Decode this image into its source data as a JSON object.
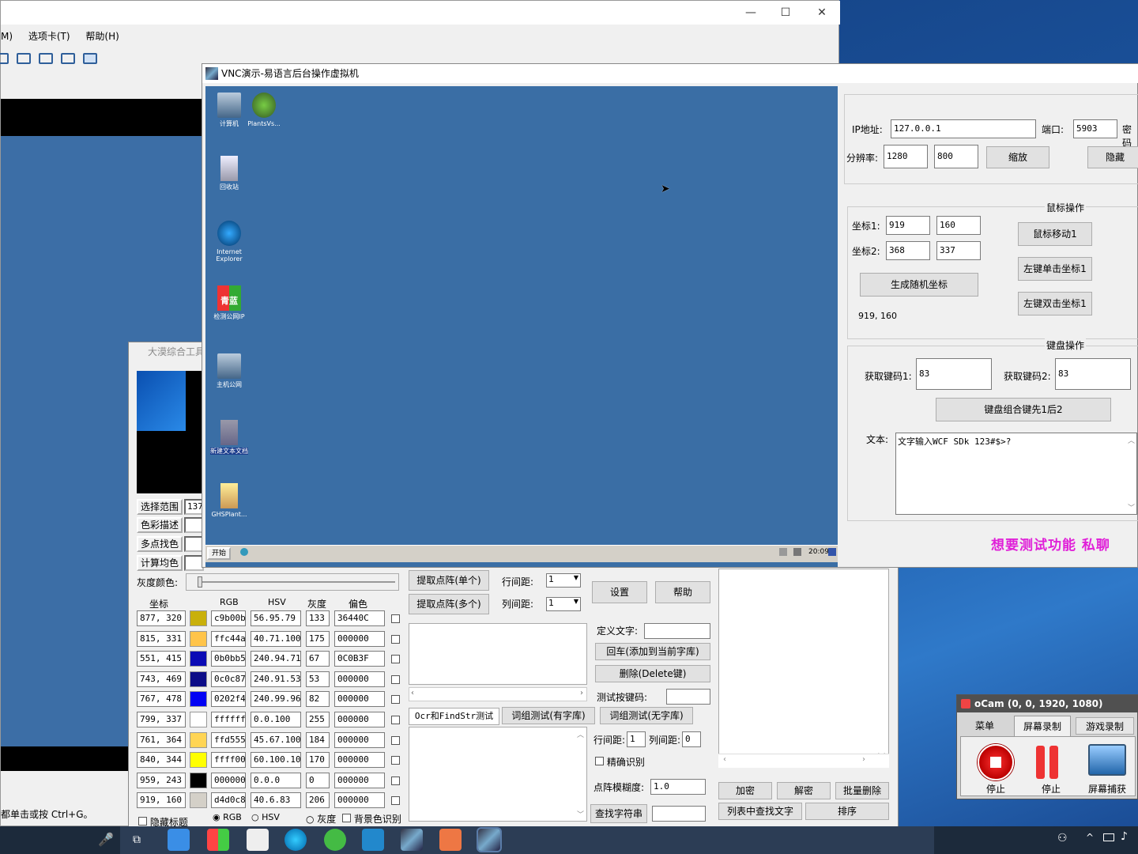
{
  "vm_window": {
    "menu": [
      "M)",
      "选项卡(T)",
      "帮助(H)"
    ],
    "status": "都单击或按 Ctrl+G。"
  },
  "vnc": {
    "title": "VNC演示-易语言后台操作虚拟机",
    "desktop_icons": [
      "计算机",
      "PlantsVs...",
      "回收站",
      "Internet Explorer",
      "检测公网IP",
      "主机公网",
      "新建文本文档",
      "GHSPlant..."
    ],
    "qinglan": "青蓝",
    "start": "开始",
    "clock": "20:09",
    "ip_label": "IP地址:",
    "ip_value": "127.0.0.1",
    "port_label": "端口:",
    "port_value": "5903",
    "pwd_label": "密码",
    "res_label": "分辨率:",
    "res_w": "1280",
    "res_h": "800",
    "zoom_btn": "缩放",
    "hide_btn": "隐藏",
    "mouse_group": "鼠标操作",
    "coord1_label": "坐标1:",
    "coord1_x": "919",
    "coord1_y": "160",
    "coord2_label": "坐标2:",
    "coord2_x": "368",
    "coord2_y": "337",
    "move_btn": "鼠标移动1",
    "lclick_btn": "左键单击坐标1",
    "ldbl_btn": "左键双击坐标1",
    "random_btn": "生成随机坐标",
    "coord_readout": "919, 160",
    "kbd_group": "键盘操作",
    "key1_label": "获取键码1:",
    "key1_value": "83",
    "key2_label": "获取键码2:",
    "key2_value": "83",
    "combo_btn": "键盘组合键先1后2",
    "text_label": "文本:",
    "text_value": "文字输入WCF SDk 123#$>?",
    "promo": "想要测试功能 私聊"
  },
  "tool": {
    "title": "大漠综合工具",
    "btn_range": "选择范围",
    "range_value": "137",
    "btn_desc": "色彩描述",
    "btn_multi": "多点找色",
    "btn_avg": "计算均色",
    "gray_label": "灰度颜色:",
    "headers": [
      "坐标",
      "RGB",
      "HSV",
      "灰度",
      "偏色"
    ],
    "rows": [
      {
        "coord": "877, 320",
        "color": "#c9b00b",
        "rgb": "c9b00b",
        "hsv": "56.95.79",
        "gray": "133",
        "offset": "36440C"
      },
      {
        "coord": "815, 331",
        "color": "#ffc44a",
        "rgb": "ffc44a",
        "hsv": "40.71.100",
        "gray": "175",
        "offset": "000000"
      },
      {
        "coord": "551, 415",
        "color": "#0b0bb5",
        "rgb": "0b0bb5",
        "hsv": "240.94.71",
        "gray": "67",
        "offset": "0C0B3F"
      },
      {
        "coord": "743, 469",
        "color": "#0c0c87",
        "rgb": "0c0c87",
        "hsv": "240.91.53",
        "gray": "53",
        "offset": "000000"
      },
      {
        "coord": "767, 478",
        "color": "#0202f4",
        "rgb": "0202f4",
        "hsv": "240.99.96",
        "gray": "82",
        "offset": "000000"
      },
      {
        "coord": "799, 337",
        "color": "#ffffff",
        "rgb": "ffffff",
        "hsv": "0.0.100",
        "gray": "255",
        "offset": "000000"
      },
      {
        "coord": "761, 364",
        "color": "#ffd555",
        "rgb": "ffd555",
        "hsv": "45.67.100",
        "gray": "184",
        "offset": "000000"
      },
      {
        "coord": "840, 344",
        "color": "#ffff00",
        "rgb": "ffff00",
        "hsv": "60.100.100",
        "gray": "170",
        "offset": "000000"
      },
      {
        "coord": "959, 243",
        "color": "#000000",
        "rgb": "000000",
        "hsv": "0.0.0",
        "gray": "0",
        "offset": "000000"
      },
      {
        "coord": "919, 160",
        "color": "#d4d0c8",
        "rgb": "d4d0c8",
        "hsv": "40.6.83",
        "gray": "206",
        "offset": "000000"
      }
    ],
    "hide_title": "隐藏标题",
    "radio_rgb": "RGB",
    "radio_hsv": "HSV",
    "radio_gray": "灰度",
    "bg_color": "背景色识别",
    "btn_lattice_single": "提取点阵(单个)",
    "btn_lattice_multi": "提取点阵(多个)",
    "row_gap_label": "行间距:",
    "row_gap": "1",
    "col_gap_label": "列间距:",
    "col_gap": "1",
    "btn_settings": "设置",
    "btn_help": "帮助",
    "define_text": "定义文字:",
    "btn_enter": "回车(添加到当前字库)",
    "btn_delete": "删除(Delete键)",
    "test_key": "测试按键码:",
    "tab_ocr": "Ocr和FindStr测试",
    "tab_group1": "词组测试(有字库)",
    "tab_group2": "词组测试(无字库)",
    "row_gap2_label": "行间距:",
    "row_gap2": "1",
    "col_gap2_label": "列间距:",
    "col_gap2": "0",
    "exact": "精确识别",
    "blur_label": "点阵模糊度:",
    "blur_value": "1.0",
    "btn_find": "查找字符串",
    "btn_encrypt": "加密",
    "btn_decrypt": "解密",
    "btn_batch_del": "批量删除",
    "btn_list_find": "列表中查找文字",
    "btn_sort": "排序"
  },
  "ocam": {
    "title": "oCam (0, 0, 1920, 1080)",
    "tabs": [
      "菜单",
      "屏幕录制",
      "游戏录制"
    ],
    "buttons": [
      "停止",
      "停止",
      "屏幕捕获"
    ]
  }
}
